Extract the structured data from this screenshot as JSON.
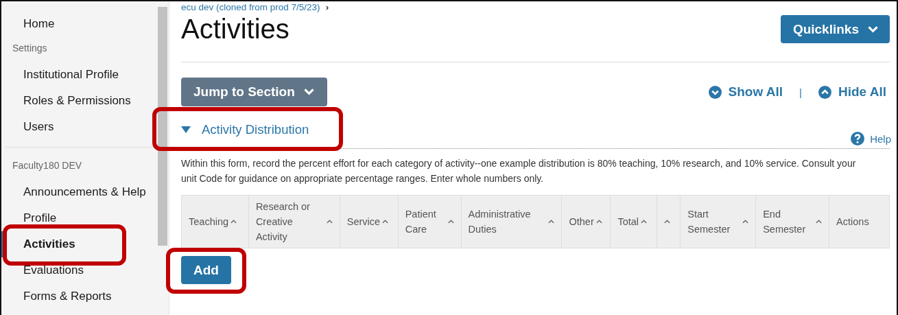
{
  "sidebar": {
    "items": [
      {
        "kind": "link",
        "label": "Home",
        "selected": false,
        "highlighted": false
      },
      {
        "kind": "heading",
        "label": "Settings"
      },
      {
        "kind": "link",
        "label": "Institutional Profile",
        "selected": false,
        "highlighted": false
      },
      {
        "kind": "link",
        "label": "Roles & Permissions",
        "selected": false,
        "highlighted": false
      },
      {
        "kind": "link",
        "label": "Users",
        "selected": false,
        "highlighted": false
      },
      {
        "kind": "divider"
      },
      {
        "kind": "heading",
        "label": "Faculty180 DEV"
      },
      {
        "kind": "link",
        "label": "Announcements & Help",
        "selected": false,
        "highlighted": false
      },
      {
        "kind": "link",
        "label": "Profile",
        "selected": false,
        "highlighted": false
      },
      {
        "kind": "link",
        "label": "Activities",
        "selected": true,
        "highlighted": true
      },
      {
        "kind": "link",
        "label": "Evaluations",
        "selected": false,
        "highlighted": false
      },
      {
        "kind": "link",
        "label": "Forms & Reports",
        "selected": false,
        "highlighted": false
      }
    ]
  },
  "breadcrumb": {
    "label": "ecu dev (cloned from prod 7/5/23)",
    "separator": "›"
  },
  "page_title": "Activities",
  "quicklinks_button": "Quicklinks",
  "jump_button": "Jump to Section",
  "show_all": "Show All",
  "separator": "|",
  "hide_all": "Hide All",
  "section": {
    "title": "Activity Distribution",
    "expanded": true,
    "highlighted": true,
    "help": "Help",
    "description": "Within this form, record the percent effort for each category of activity--one example distribution is 80% teaching, 10% research, and 10% service. Consult your unit Code for guidance on appropriate percentage ranges. Enter whole numbers only.",
    "table": {
      "columns": [
        {
          "label": "Teaching",
          "sortable": true,
          "inline_sort": true
        },
        {
          "label": "Research or Creative Activity",
          "sortable": true,
          "inline_sort": false
        },
        {
          "label": "Service",
          "sortable": true,
          "inline_sort": true
        },
        {
          "label": "Patient Care",
          "sortable": true,
          "inline_sort": false
        },
        {
          "label": "Administrative Duties",
          "sortable": true,
          "inline_sort": false
        },
        {
          "label": "Other",
          "sortable": true,
          "inline_sort": true
        },
        {
          "label": "Total",
          "sortable": true,
          "inline_sort": true
        },
        {
          "sortable": true,
          "inline_sort": false
        },
        {
          "label": "Start Semester",
          "sortable": true,
          "inline_sort": false
        },
        {
          "label": "End Semester",
          "sortable": true,
          "inline_sort": false
        },
        {
          "label": "Actions",
          "sortable": false
        }
      ]
    },
    "add_button": {
      "label": "Add",
      "highlighted": true
    }
  }
}
